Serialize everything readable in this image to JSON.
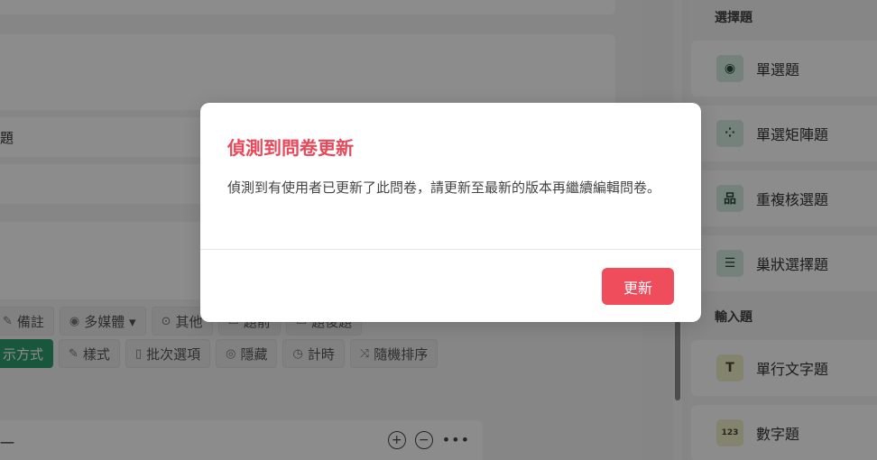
{
  "editor": {
    "card_fragment_1": "題",
    "option_fragment": "一",
    "toolbar1": [
      {
        "icon": "note-icon",
        "glyph": "✎",
        "label": "備註"
      },
      {
        "icon": "camera-icon",
        "glyph": "◉",
        "label": "多媒體 ▾"
      },
      {
        "icon": "circle-icon",
        "glyph": "⊙",
        "label": "其他"
      },
      {
        "icon": "hidden-icon",
        "glyph": "▭",
        "label": "題前"
      },
      {
        "icon": "box-icon",
        "glyph": "▭",
        "label": "題後題"
      }
    ],
    "toolbar2": [
      {
        "icon": "",
        "glyph": "",
        "label": "示方式",
        "active": true
      },
      {
        "icon": "brush-icon",
        "glyph": "✎",
        "label": "樣式"
      },
      {
        "icon": "file-icon",
        "glyph": "▯",
        "label": "批次選項"
      },
      {
        "icon": "eye-icon",
        "glyph": "◎",
        "label": "隱藏"
      },
      {
        "icon": "clock-icon",
        "glyph": "◷",
        "label": "計時"
      },
      {
        "icon": "shuffle-icon",
        "glyph": "⤨",
        "label": "隨機排序"
      }
    ]
  },
  "sidebar": {
    "section_choice": "選擇題",
    "section_input": "輸入題",
    "items": [
      {
        "label": "單選題",
        "icon": "radio-icon",
        "glyph": "◉"
      },
      {
        "label": "單選矩陣題",
        "icon": "matrix-icon",
        "glyph": "⁘"
      },
      {
        "label": "重複核選題",
        "icon": "hierarchy-icon",
        "glyph": "品"
      },
      {
        "label": "巢狀選擇題",
        "icon": "nested-icon",
        "glyph": "☰"
      },
      {
        "label": "單行文字題",
        "icon": "text-icon",
        "glyph": "T"
      },
      {
        "label": "數字題",
        "icon": "number-icon",
        "glyph": "123"
      }
    ]
  },
  "dialog": {
    "title": "偵測到問卷更新",
    "message": "偵測到有使用者已更新了此問卷，請更新至最新的版本再繼續編輯問卷。",
    "button_label": "更新"
  }
}
